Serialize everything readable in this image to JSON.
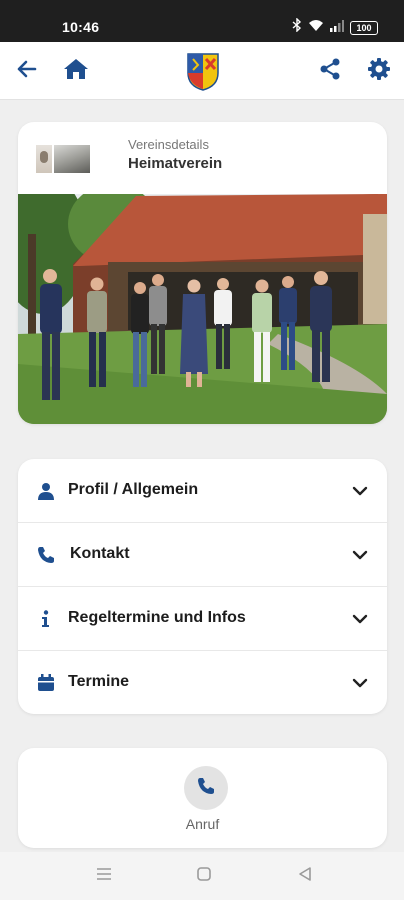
{
  "status_bar": {
    "time": "10:46",
    "battery": "100"
  },
  "app_bar": {
    "back_icon": "back-arrow-icon",
    "home_icon": "home-icon",
    "logo": "municipal-coat-of-arms",
    "share_icon": "share-icon",
    "settings_icon": "gear-icon"
  },
  "club": {
    "section_label": "Vereinsdetails",
    "name": "Heimatverein"
  },
  "menu": {
    "items": [
      {
        "label": "Profil / Allgemein",
        "icon": "person-icon"
      },
      {
        "label": "Kontakt",
        "icon": "phone-icon"
      },
      {
        "label": "Regeltermine und Infos",
        "icon": "info-icon"
      },
      {
        "label": "Termine",
        "icon": "calendar-icon"
      }
    ]
  },
  "actions": {
    "call_label": "Anruf"
  },
  "colors": {
    "accent": "#1f4f8f",
    "background": "#efefef",
    "card": "#ffffff",
    "status_bar": "#1f1f1f"
  }
}
